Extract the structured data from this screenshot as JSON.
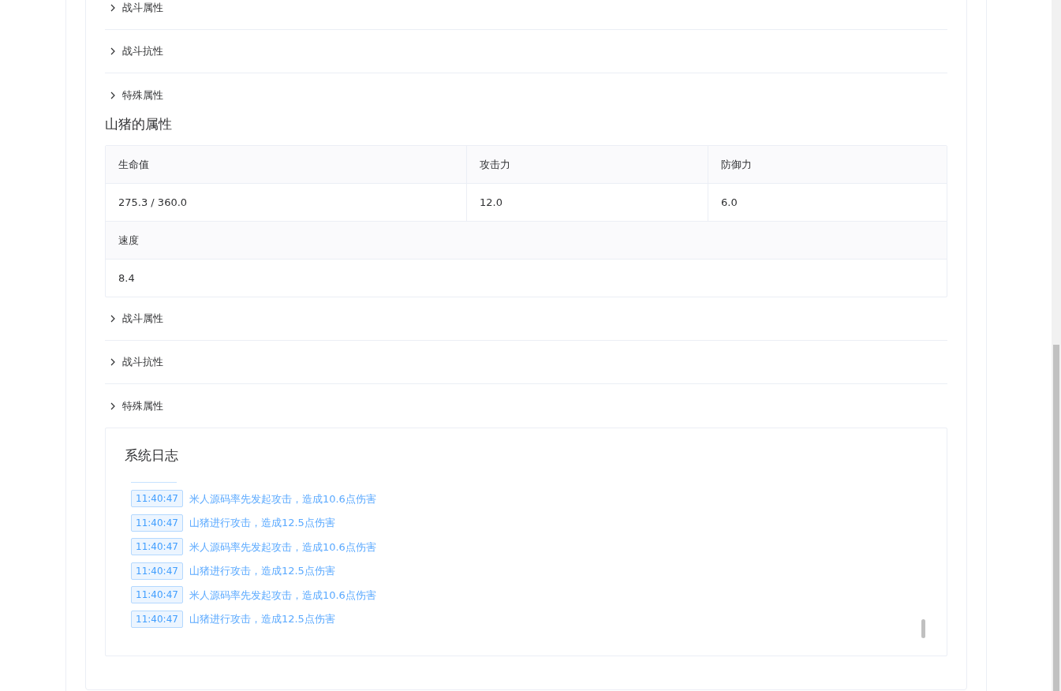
{
  "player_panels": [
    {
      "label": "战斗属性",
      "expanded": false
    },
    {
      "label": "战斗抗性",
      "expanded": false
    },
    {
      "label": "特殊属性",
      "expanded": false
    }
  ],
  "monster": {
    "title": "山猪的属性",
    "stat_rows": [
      [
        {
          "label": "生命值",
          "value": "275.3 / 360.0"
        },
        {
          "label": "攻击力",
          "value": "12.0"
        },
        {
          "label": "防御力",
          "value": "6.0"
        }
      ],
      [
        {
          "label": "速度",
          "value": "8.4"
        }
      ]
    ]
  },
  "monster_panels": [
    {
      "label": "战斗属性",
      "expanded": false
    },
    {
      "label": "战斗抗性",
      "expanded": false
    },
    {
      "label": "特殊属性",
      "expanded": false
    }
  ],
  "log": {
    "title": "系统日志",
    "entries": [
      {
        "time": "11:40:47",
        "text": "米人源码率先发起攻击，造成10.6点伤害"
      },
      {
        "time": "11:40:47",
        "text": "山猪进行攻击，造成12.5点伤害"
      },
      {
        "time": "11:40:47",
        "text": "米人源码率先发起攻击，造成10.6点伤害"
      },
      {
        "time": "11:40:47",
        "text": "山猪进行攻击，造成12.5点伤害"
      },
      {
        "time": "11:40:47",
        "text": "米人源码率先发起攻击，造成10.6点伤害"
      },
      {
        "time": "11:40:47",
        "text": "山猪进行攻击，造成12.5点伤害"
      }
    ]
  }
}
